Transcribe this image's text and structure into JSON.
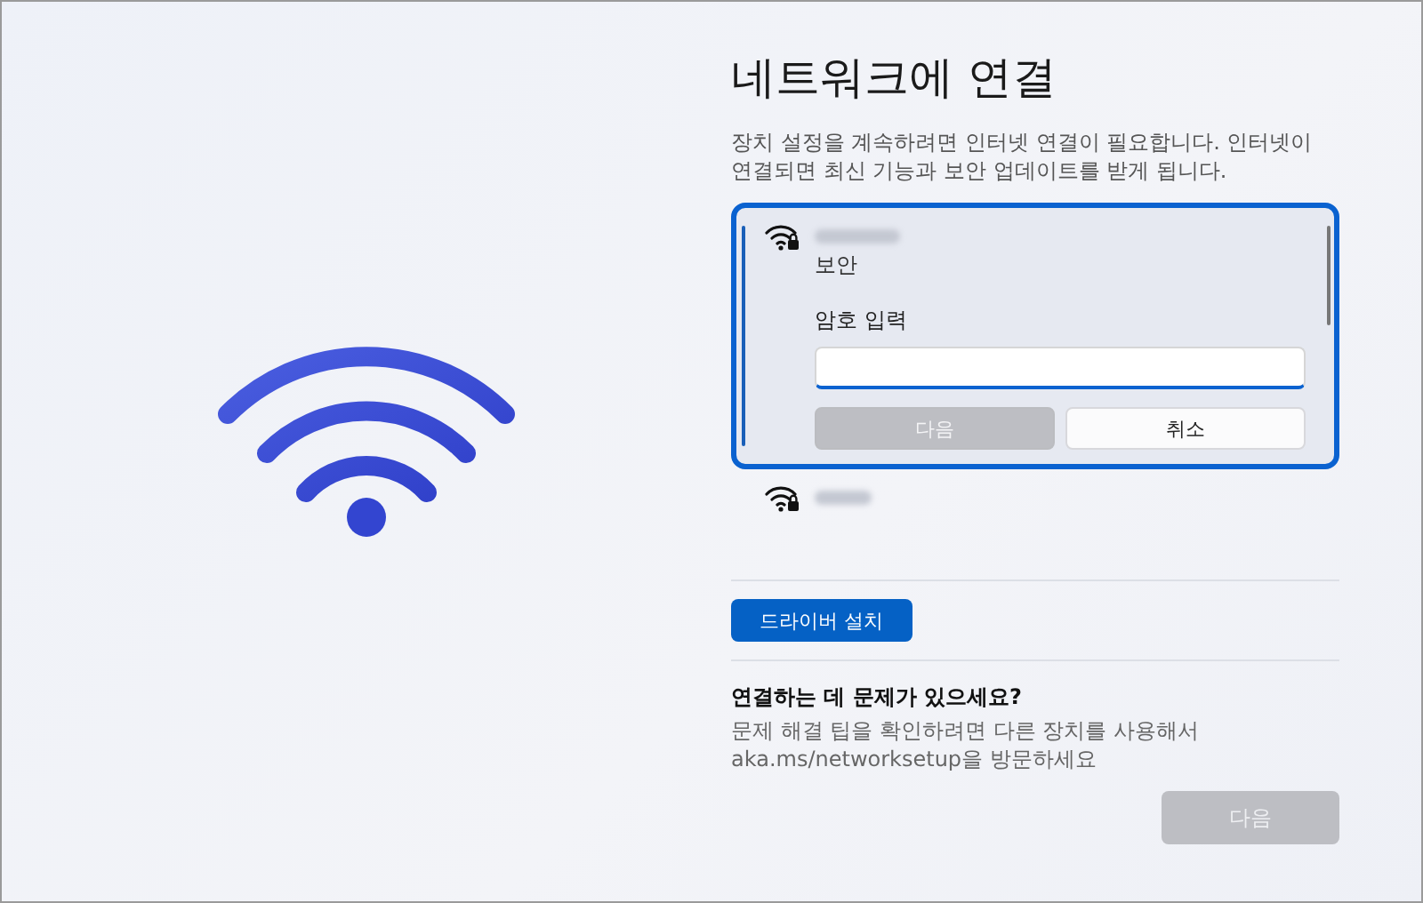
{
  "title": "네트워크에 연결",
  "description": "장치 설정을 계속하려면 인터넷 연결이 필요합니다. 인터넷이 연결되면 최신 기능과 보안 업데이트를 받게 됩니다.",
  "networks": [
    {
      "security": "보안",
      "expanded": true,
      "password_label": "암호 입력",
      "buttons": [
        {
          "label": "다음",
          "disabled": true
        },
        {
          "label": "취소",
          "disabled": false
        }
      ]
    },
    {
      "expanded": false
    }
  ],
  "driver_button": "드라이버 설치",
  "help": {
    "heading": "연결하는 데 문제가 있으세요?",
    "text": "문제 해결 팁을 확인하려면 다른 장치를 사용해서 aka.ms/networksetup을 방문하세요"
  },
  "next_button": {
    "label": "다음",
    "disabled": true
  }
}
